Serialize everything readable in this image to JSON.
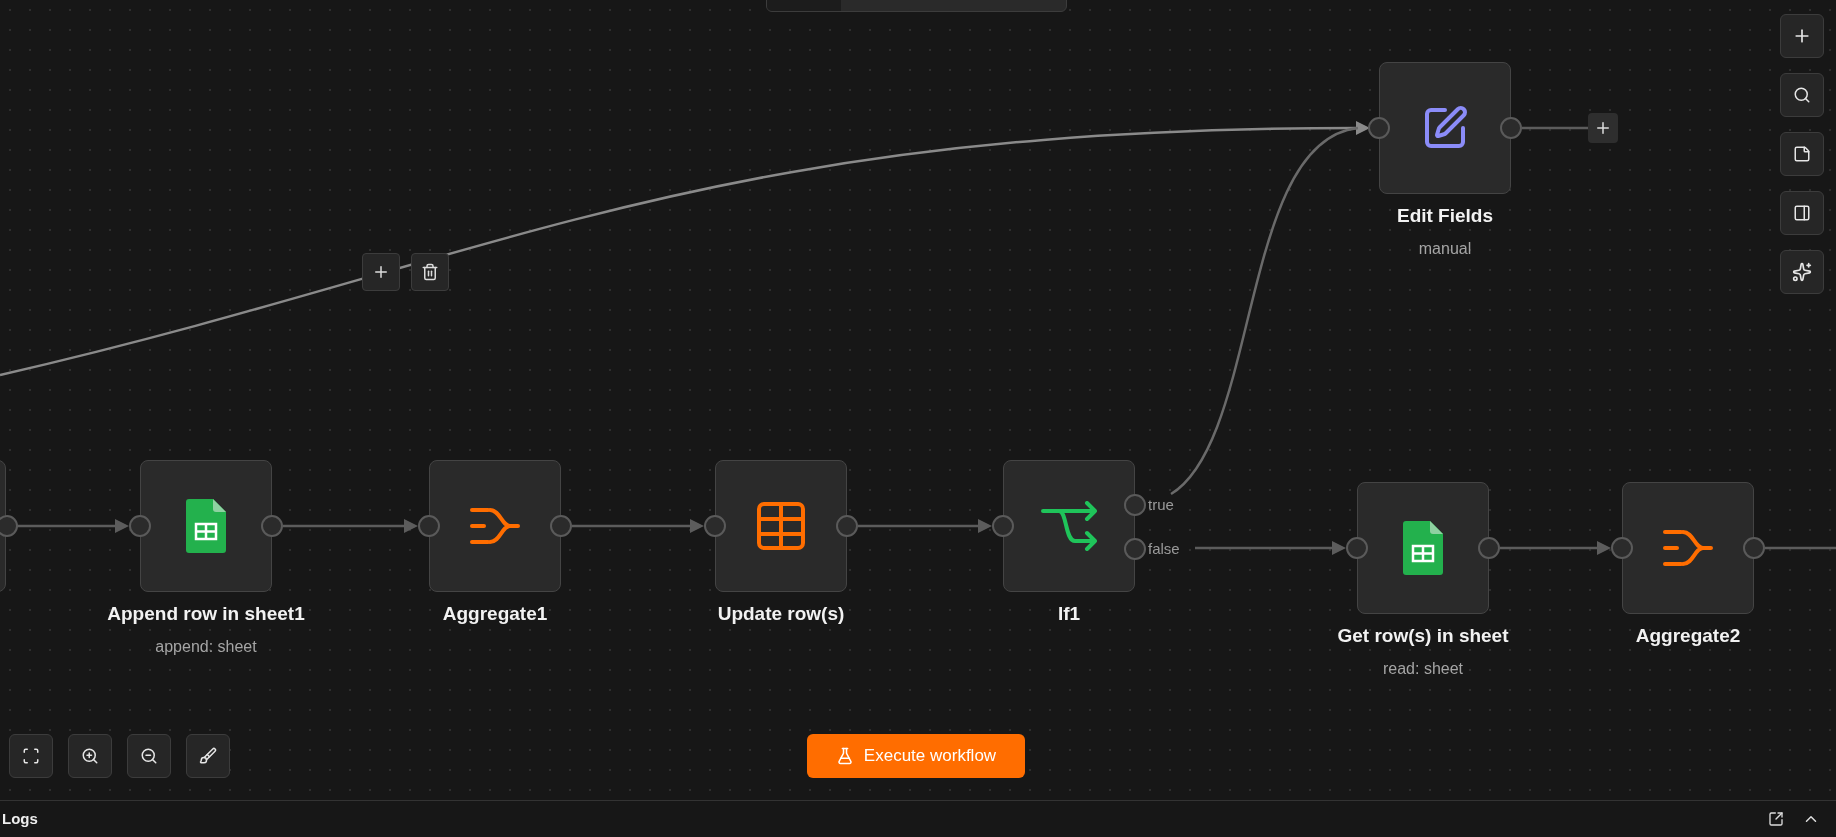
{
  "nodes": [
    {
      "kind": "edit",
      "name": "Edit Fields",
      "subtitle": "manual"
    },
    {
      "kind": "sheets",
      "name": "Append row in sheet1",
      "subtitle": "append: sheet"
    },
    {
      "kind": "aggregate",
      "name": "Aggregate1"
    },
    {
      "kind": "table",
      "name": "Update row(s)"
    },
    {
      "kind": "if",
      "name": "If1",
      "outputs": [
        "true",
        "false"
      ]
    },
    {
      "kind": "sheets",
      "name": "Get row(s) in sheet",
      "subtitle": "read: sheet"
    },
    {
      "kind": "aggregate",
      "name": "Aggregate2"
    }
  ],
  "execute_button": "Execute workflow",
  "logs": {
    "title": "Logs"
  }
}
